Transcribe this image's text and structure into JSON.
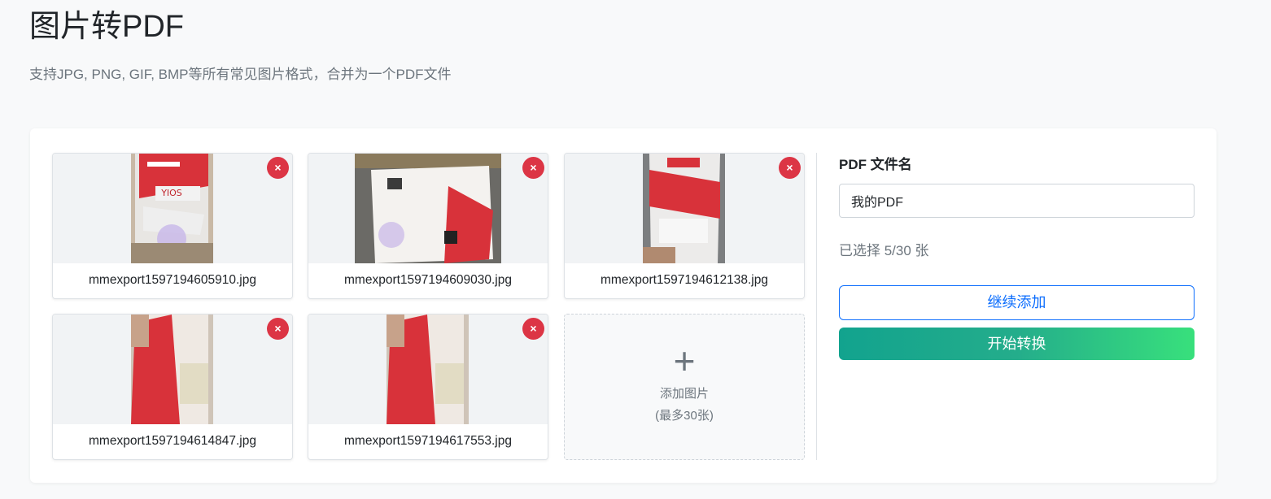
{
  "header": {
    "title": "图片转PDF",
    "subtitle": "支持JPG, PNG, GIF, BMP等所有常见图片格式，合并为一个PDF文件"
  },
  "images": [
    {
      "filename": "mmexport1597194605910.jpg",
      "remove_label": "×"
    },
    {
      "filename": "mmexport1597194609030.jpg",
      "remove_label": "×"
    },
    {
      "filename": "mmexport1597194612138.jpg",
      "remove_label": "×"
    },
    {
      "filename": "mmexport1597194614847.jpg",
      "remove_label": "×"
    },
    {
      "filename": "mmexport1597194617553.jpg",
      "remove_label": "×"
    }
  ],
  "add_tile": {
    "icon": "+",
    "label": "添加图片",
    "hint": "(最多30张)"
  },
  "side": {
    "filename_label": "PDF 文件名",
    "filename_value": "我的PDF",
    "count_text": "已选择 5/30 张",
    "continue_button": "继续添加",
    "convert_button": "开始转换"
  },
  "colors": {
    "accent": "#0d6efd",
    "danger": "#dc3545",
    "gradient_start": "#12a38e",
    "gradient_end": "#38e07c"
  }
}
